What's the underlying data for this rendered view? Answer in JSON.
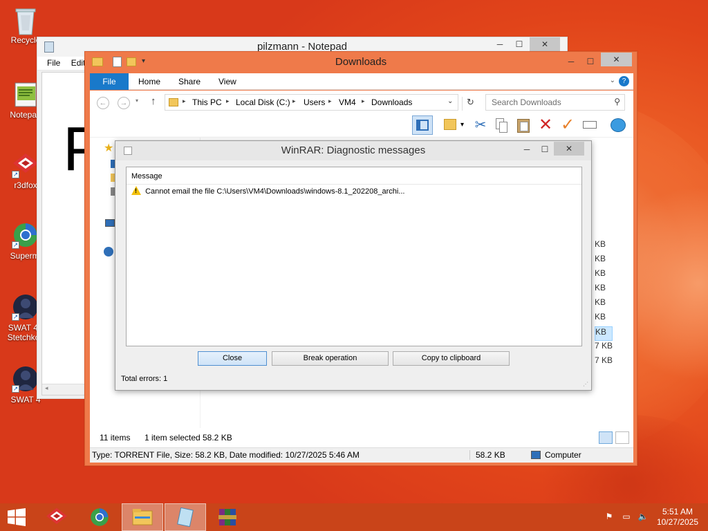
{
  "desktop": {
    "icons": [
      {
        "label": "Recycle"
      },
      {
        "label": "Notepad"
      },
      {
        "label": "r3dfox"
      },
      {
        "label": "Supermi"
      },
      {
        "label": "SWAT 4 -",
        "label2": "Stetchkov"
      },
      {
        "label": "SWAT 4"
      }
    ]
  },
  "notepad": {
    "title": "pilzmann - Notepad",
    "menu": [
      "File",
      "Edit"
    ],
    "body_text": "P"
  },
  "explorer": {
    "title": "Downloads",
    "tabs": [
      "File",
      "Home",
      "Share",
      "View"
    ],
    "breadcrumb": [
      "This PC",
      "Local Disk (C:)",
      "Users",
      "VM4",
      "Downloads"
    ],
    "search_placeholder": "Search Downloads",
    "sizes": [
      "KB",
      "KB",
      "KB",
      "KB",
      "KB",
      "KB",
      "KB",
      "KB",
      "KB"
    ],
    "sizes_prefix": [
      "",
      "",
      "",
      "",
      "",
      "",
      "",
      "7",
      "7"
    ],
    "status": {
      "items": "11 items",
      "selected": "1 item selected",
      "selected_size": "58.2 KB"
    },
    "details": {
      "info": "Type: TORRENT File, Size: 58.2 KB, Date modified: 10/27/2025 5:46 AM",
      "size": "58.2 KB",
      "location": "Computer"
    }
  },
  "winrar": {
    "title": "WinRAR: Diagnostic messages",
    "column_header": "Message",
    "messages": [
      "Cannot email the file C:\\Users\\VM4\\Downloads\\windows-8.1_202208_archi..."
    ],
    "buttons": {
      "close": "Close",
      "break": "Break operation",
      "copy": "Copy to clipboard"
    },
    "total_errors": "Total errors: 1"
  },
  "taskbar": {
    "time": "5:51 AM",
    "date": "10/27/2025"
  },
  "colors": {
    "desktop": "#e4461f",
    "file_tab": "#1979ca",
    "taskbar": "#c94419",
    "explorer_frame": "#ef7a4a"
  }
}
